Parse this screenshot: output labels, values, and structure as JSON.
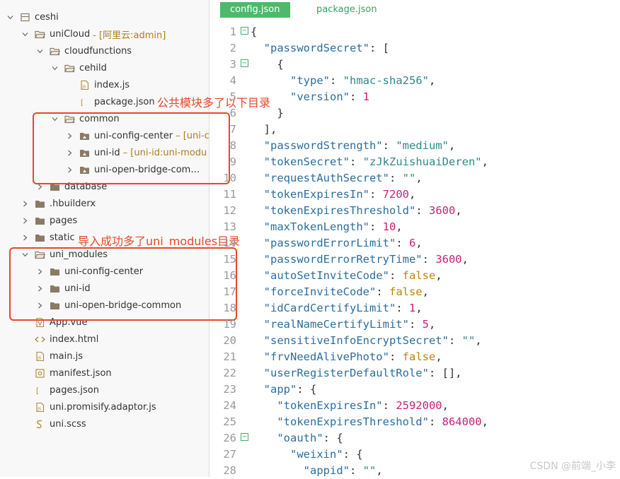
{
  "colors": {
    "accent_green": "#4db96b",
    "annotation_red": "#e8472c",
    "folder": "#8a7a66",
    "suffix_gold": "#b07d1c"
  },
  "sidebar": {
    "rows": [
      {
        "label": "ceshi",
        "depth": 0,
        "icon": "project-icon",
        "chev": "down"
      },
      {
        "label": "uniCloud",
        "suffix": "- [阿里云:admin]",
        "depth": 1,
        "icon": "folder-open-icon",
        "chev": "down"
      },
      {
        "label": "cloudfunctions",
        "depth": 2,
        "icon": "folder-open-icon",
        "chev": "down"
      },
      {
        "label": "cehild",
        "depth": 3,
        "icon": "folder-open-icon",
        "chev": "down"
      },
      {
        "label": "index.js",
        "depth": 4,
        "icon": "js-file-icon",
        "chev": ""
      },
      {
        "label": "package.json",
        "depth": 4,
        "icon": "json-file-icon",
        "chev": ""
      },
      {
        "label": "common",
        "depth": 3,
        "icon": "folder-open-icon",
        "chev": "down"
      },
      {
        "label": "uni-config-center",
        "suffix": "– [uni-c",
        "depth": 4,
        "icon": "module-folder-icon",
        "chev": "right"
      },
      {
        "label": "uni-id",
        "suffix": "– [uni-id:uni-modu",
        "depth": 4,
        "icon": "module-folder-icon",
        "chev": "right"
      },
      {
        "label": "uni-open-bridge-com…",
        "depth": 4,
        "icon": "module-folder-icon",
        "chev": "right"
      },
      {
        "label": "database",
        "depth": 2,
        "icon": "folder-icon",
        "chev": "right"
      },
      {
        "label": ".hbuilderx",
        "depth": 1,
        "icon": "folder-icon",
        "chev": "right"
      },
      {
        "label": "pages",
        "depth": 1,
        "icon": "folder-icon",
        "chev": "right"
      },
      {
        "label": "static",
        "depth": 1,
        "icon": "folder-icon",
        "chev": "right"
      },
      {
        "label": "uni_modules",
        "depth": 1,
        "icon": "folder-open-icon",
        "chev": "down"
      },
      {
        "label": "uni-config-center",
        "depth": 2,
        "icon": "folder-icon",
        "chev": "right"
      },
      {
        "label": "uni-id",
        "depth": 2,
        "icon": "folder-icon",
        "chev": "right"
      },
      {
        "label": "uni-open-bridge-common",
        "depth": 2,
        "icon": "folder-icon",
        "chev": "right"
      },
      {
        "label": "App.vue",
        "depth": 1,
        "icon": "vue-file-icon",
        "chev": ""
      },
      {
        "label": "index.html",
        "depth": 1,
        "icon": "html-file-icon",
        "chev": ""
      },
      {
        "label": "main.js",
        "depth": 1,
        "icon": "js-file-icon",
        "chev": ""
      },
      {
        "label": "manifest.json",
        "depth": 1,
        "icon": "manifest-file-icon",
        "chev": ""
      },
      {
        "label": "pages.json",
        "depth": 1,
        "icon": "json-file-icon",
        "chev": ""
      },
      {
        "label": "uni.promisify.adaptor.js",
        "depth": 1,
        "icon": "js-file-icon",
        "chev": ""
      },
      {
        "label": "uni.scss",
        "depth": 1,
        "icon": "scss-file-icon",
        "chev": ""
      }
    ]
  },
  "annotations": {
    "note_common": "公共模块多了以下目录",
    "note_uni_modules": "导入成功多了uni_modules目录"
  },
  "editor": {
    "tabs": [
      "config.json",
      "package.json"
    ],
    "active_tab": "config.json",
    "lines": [
      {
        "n": "1",
        "fold": true,
        "tokens": [
          {
            "t": "p",
            "v": "{"
          }
        ]
      },
      {
        "n": "2",
        "fold": false,
        "tokens": [
          {
            "t": "p",
            "v": "  "
          },
          {
            "t": "k",
            "v": "\"passwordSecret\""
          },
          {
            "t": "p",
            "v": ": ["
          }
        ]
      },
      {
        "n": "3",
        "fold": true,
        "tokens": [
          {
            "t": "p",
            "v": "    {"
          }
        ]
      },
      {
        "n": "4",
        "fold": false,
        "tokens": [
          {
            "t": "p",
            "v": "      "
          },
          {
            "t": "k",
            "v": "\"type\""
          },
          {
            "t": "p",
            "v": ": "
          },
          {
            "t": "s",
            "v": "\"hmac-sha256\""
          },
          {
            "t": "p",
            "v": ","
          }
        ]
      },
      {
        "n": "5",
        "fold": false,
        "tokens": [
          {
            "t": "p",
            "v": "      "
          },
          {
            "t": "k",
            "v": "\"version\""
          },
          {
            "t": "p",
            "v": ": "
          },
          {
            "t": "n",
            "v": "1"
          }
        ]
      },
      {
        "n": "6",
        "fold": false,
        "tokens": [
          {
            "t": "p",
            "v": "    }"
          }
        ]
      },
      {
        "n": "7",
        "fold": false,
        "tokens": [
          {
            "t": "p",
            "v": "  ],"
          }
        ]
      },
      {
        "n": "8",
        "fold": false,
        "tokens": [
          {
            "t": "p",
            "v": "  "
          },
          {
            "t": "k",
            "v": "\"passwordStrength\""
          },
          {
            "t": "p",
            "v": ": "
          },
          {
            "t": "s",
            "v": "\"medium\""
          },
          {
            "t": "p",
            "v": ","
          }
        ]
      },
      {
        "n": "9",
        "fold": false,
        "tokens": [
          {
            "t": "p",
            "v": "  "
          },
          {
            "t": "k",
            "v": "\"tokenSecret\""
          },
          {
            "t": "p",
            "v": ": "
          },
          {
            "t": "s",
            "v": "\"zJkZuishuaiDeren\""
          },
          {
            "t": "p",
            "v": ","
          }
        ]
      },
      {
        "n": "10",
        "fold": false,
        "tokens": [
          {
            "t": "p",
            "v": "  "
          },
          {
            "t": "k",
            "v": "\"requestAuthSecret\""
          },
          {
            "t": "p",
            "v": ": "
          },
          {
            "t": "s",
            "v": "\"\""
          },
          {
            "t": "p",
            "v": ","
          }
        ]
      },
      {
        "n": "11",
        "fold": false,
        "tokens": [
          {
            "t": "p",
            "v": "  "
          },
          {
            "t": "k",
            "v": "\"tokenExpiresIn\""
          },
          {
            "t": "p",
            "v": ": "
          },
          {
            "t": "n",
            "v": "7200"
          },
          {
            "t": "p",
            "v": ","
          }
        ]
      },
      {
        "n": "12",
        "fold": false,
        "tokens": [
          {
            "t": "p",
            "v": "  "
          },
          {
            "t": "k",
            "v": "\"tokenExpiresThreshold\""
          },
          {
            "t": "p",
            "v": ": "
          },
          {
            "t": "n",
            "v": "3600"
          },
          {
            "t": "p",
            "v": ","
          }
        ]
      },
      {
        "n": "13",
        "fold": false,
        "tokens": [
          {
            "t": "p",
            "v": "  "
          },
          {
            "t": "k",
            "v": "\"maxTokenLength\""
          },
          {
            "t": "p",
            "v": ": "
          },
          {
            "t": "n",
            "v": "10"
          },
          {
            "t": "p",
            "v": ","
          }
        ]
      },
      {
        "n": "14",
        "fold": false,
        "tokens": [
          {
            "t": "p",
            "v": "  "
          },
          {
            "t": "k",
            "v": "\"passwordErrorLimit\""
          },
          {
            "t": "p",
            "v": ": "
          },
          {
            "t": "n",
            "v": "6"
          },
          {
            "t": "p",
            "v": ","
          }
        ]
      },
      {
        "n": "15",
        "fold": false,
        "tokens": [
          {
            "t": "p",
            "v": "  "
          },
          {
            "t": "k",
            "v": "\"passwordErrorRetryTime\""
          },
          {
            "t": "p",
            "v": ": "
          },
          {
            "t": "n",
            "v": "3600"
          },
          {
            "t": "p",
            "v": ","
          }
        ]
      },
      {
        "n": "16",
        "fold": false,
        "tokens": [
          {
            "t": "p",
            "v": "  "
          },
          {
            "t": "k",
            "v": "\"autoSetInviteCode\""
          },
          {
            "t": "p",
            "v": ": "
          },
          {
            "t": "b",
            "v": "false"
          },
          {
            "t": "p",
            "v": ","
          }
        ]
      },
      {
        "n": "17",
        "fold": false,
        "tokens": [
          {
            "t": "p",
            "v": "  "
          },
          {
            "t": "k",
            "v": "\"forceInviteCode\""
          },
          {
            "t": "p",
            "v": ": "
          },
          {
            "t": "b",
            "v": "false"
          },
          {
            "t": "p",
            "v": ","
          }
        ]
      },
      {
        "n": "18",
        "fold": false,
        "tokens": [
          {
            "t": "p",
            "v": "  "
          },
          {
            "t": "k",
            "v": "\"idCardCertifyLimit\""
          },
          {
            "t": "p",
            "v": ": "
          },
          {
            "t": "n",
            "v": "1"
          },
          {
            "t": "p",
            "v": ","
          }
        ]
      },
      {
        "n": "19",
        "fold": false,
        "tokens": [
          {
            "t": "p",
            "v": "  "
          },
          {
            "t": "k",
            "v": "\"realNameCertifyLimit\""
          },
          {
            "t": "p",
            "v": ": "
          },
          {
            "t": "n",
            "v": "5"
          },
          {
            "t": "p",
            "v": ","
          }
        ]
      },
      {
        "n": "20",
        "fold": false,
        "tokens": [
          {
            "t": "p",
            "v": "  "
          },
          {
            "t": "k",
            "v": "\"sensitiveInfoEncryptSecret\""
          },
          {
            "t": "p",
            "v": ": "
          },
          {
            "t": "s",
            "v": "\"\""
          },
          {
            "t": "p",
            "v": ","
          }
        ]
      },
      {
        "n": "21",
        "fold": false,
        "tokens": [
          {
            "t": "p",
            "v": "  "
          },
          {
            "t": "k",
            "v": "\"frvNeedAlivePhoto\""
          },
          {
            "t": "p",
            "v": ": "
          },
          {
            "t": "b",
            "v": "false"
          },
          {
            "t": "p",
            "v": ","
          }
        ]
      },
      {
        "n": "22",
        "fold": false,
        "tokens": [
          {
            "t": "p",
            "v": "  "
          },
          {
            "t": "k",
            "v": "\"userRegisterDefaultRole\""
          },
          {
            "t": "p",
            "v": ": [],"
          }
        ]
      },
      {
        "n": "23",
        "fold": false,
        "tokens": [
          {
            "t": "p",
            "v": "  "
          },
          {
            "t": "k",
            "v": "\"app\""
          },
          {
            "t": "p",
            "v": ": {"
          }
        ]
      },
      {
        "n": "24",
        "fold": false,
        "tokens": [
          {
            "t": "p",
            "v": "    "
          },
          {
            "t": "k",
            "v": "\"tokenExpiresIn\""
          },
          {
            "t": "p",
            "v": ": "
          },
          {
            "t": "n",
            "v": "2592000"
          },
          {
            "t": "p",
            "v": ","
          }
        ]
      },
      {
        "n": "25",
        "fold": false,
        "tokens": [
          {
            "t": "p",
            "v": "    "
          },
          {
            "t": "k",
            "v": "\"tokenExpiresThreshold\""
          },
          {
            "t": "p",
            "v": ": "
          },
          {
            "t": "n",
            "v": "864000"
          },
          {
            "t": "p",
            "v": ","
          }
        ]
      },
      {
        "n": "26",
        "fold": true,
        "tokens": [
          {
            "t": "p",
            "v": "    "
          },
          {
            "t": "k",
            "v": "\"oauth\""
          },
          {
            "t": "p",
            "v": ": {"
          }
        ]
      },
      {
        "n": "27",
        "fold": false,
        "tokens": [
          {
            "t": "p",
            "v": "      "
          },
          {
            "t": "k",
            "v": "\"weixin\""
          },
          {
            "t": "p",
            "v": ": {"
          }
        ]
      },
      {
        "n": "28",
        "fold": false,
        "tokens": [
          {
            "t": "p",
            "v": "        "
          },
          {
            "t": "k",
            "v": "\"appid\""
          },
          {
            "t": "p",
            "v": ": "
          },
          {
            "t": "s",
            "v": "\"\""
          },
          {
            "t": "p",
            "v": ","
          }
        ]
      }
    ]
  },
  "watermark": "CSDN @前端_小李"
}
